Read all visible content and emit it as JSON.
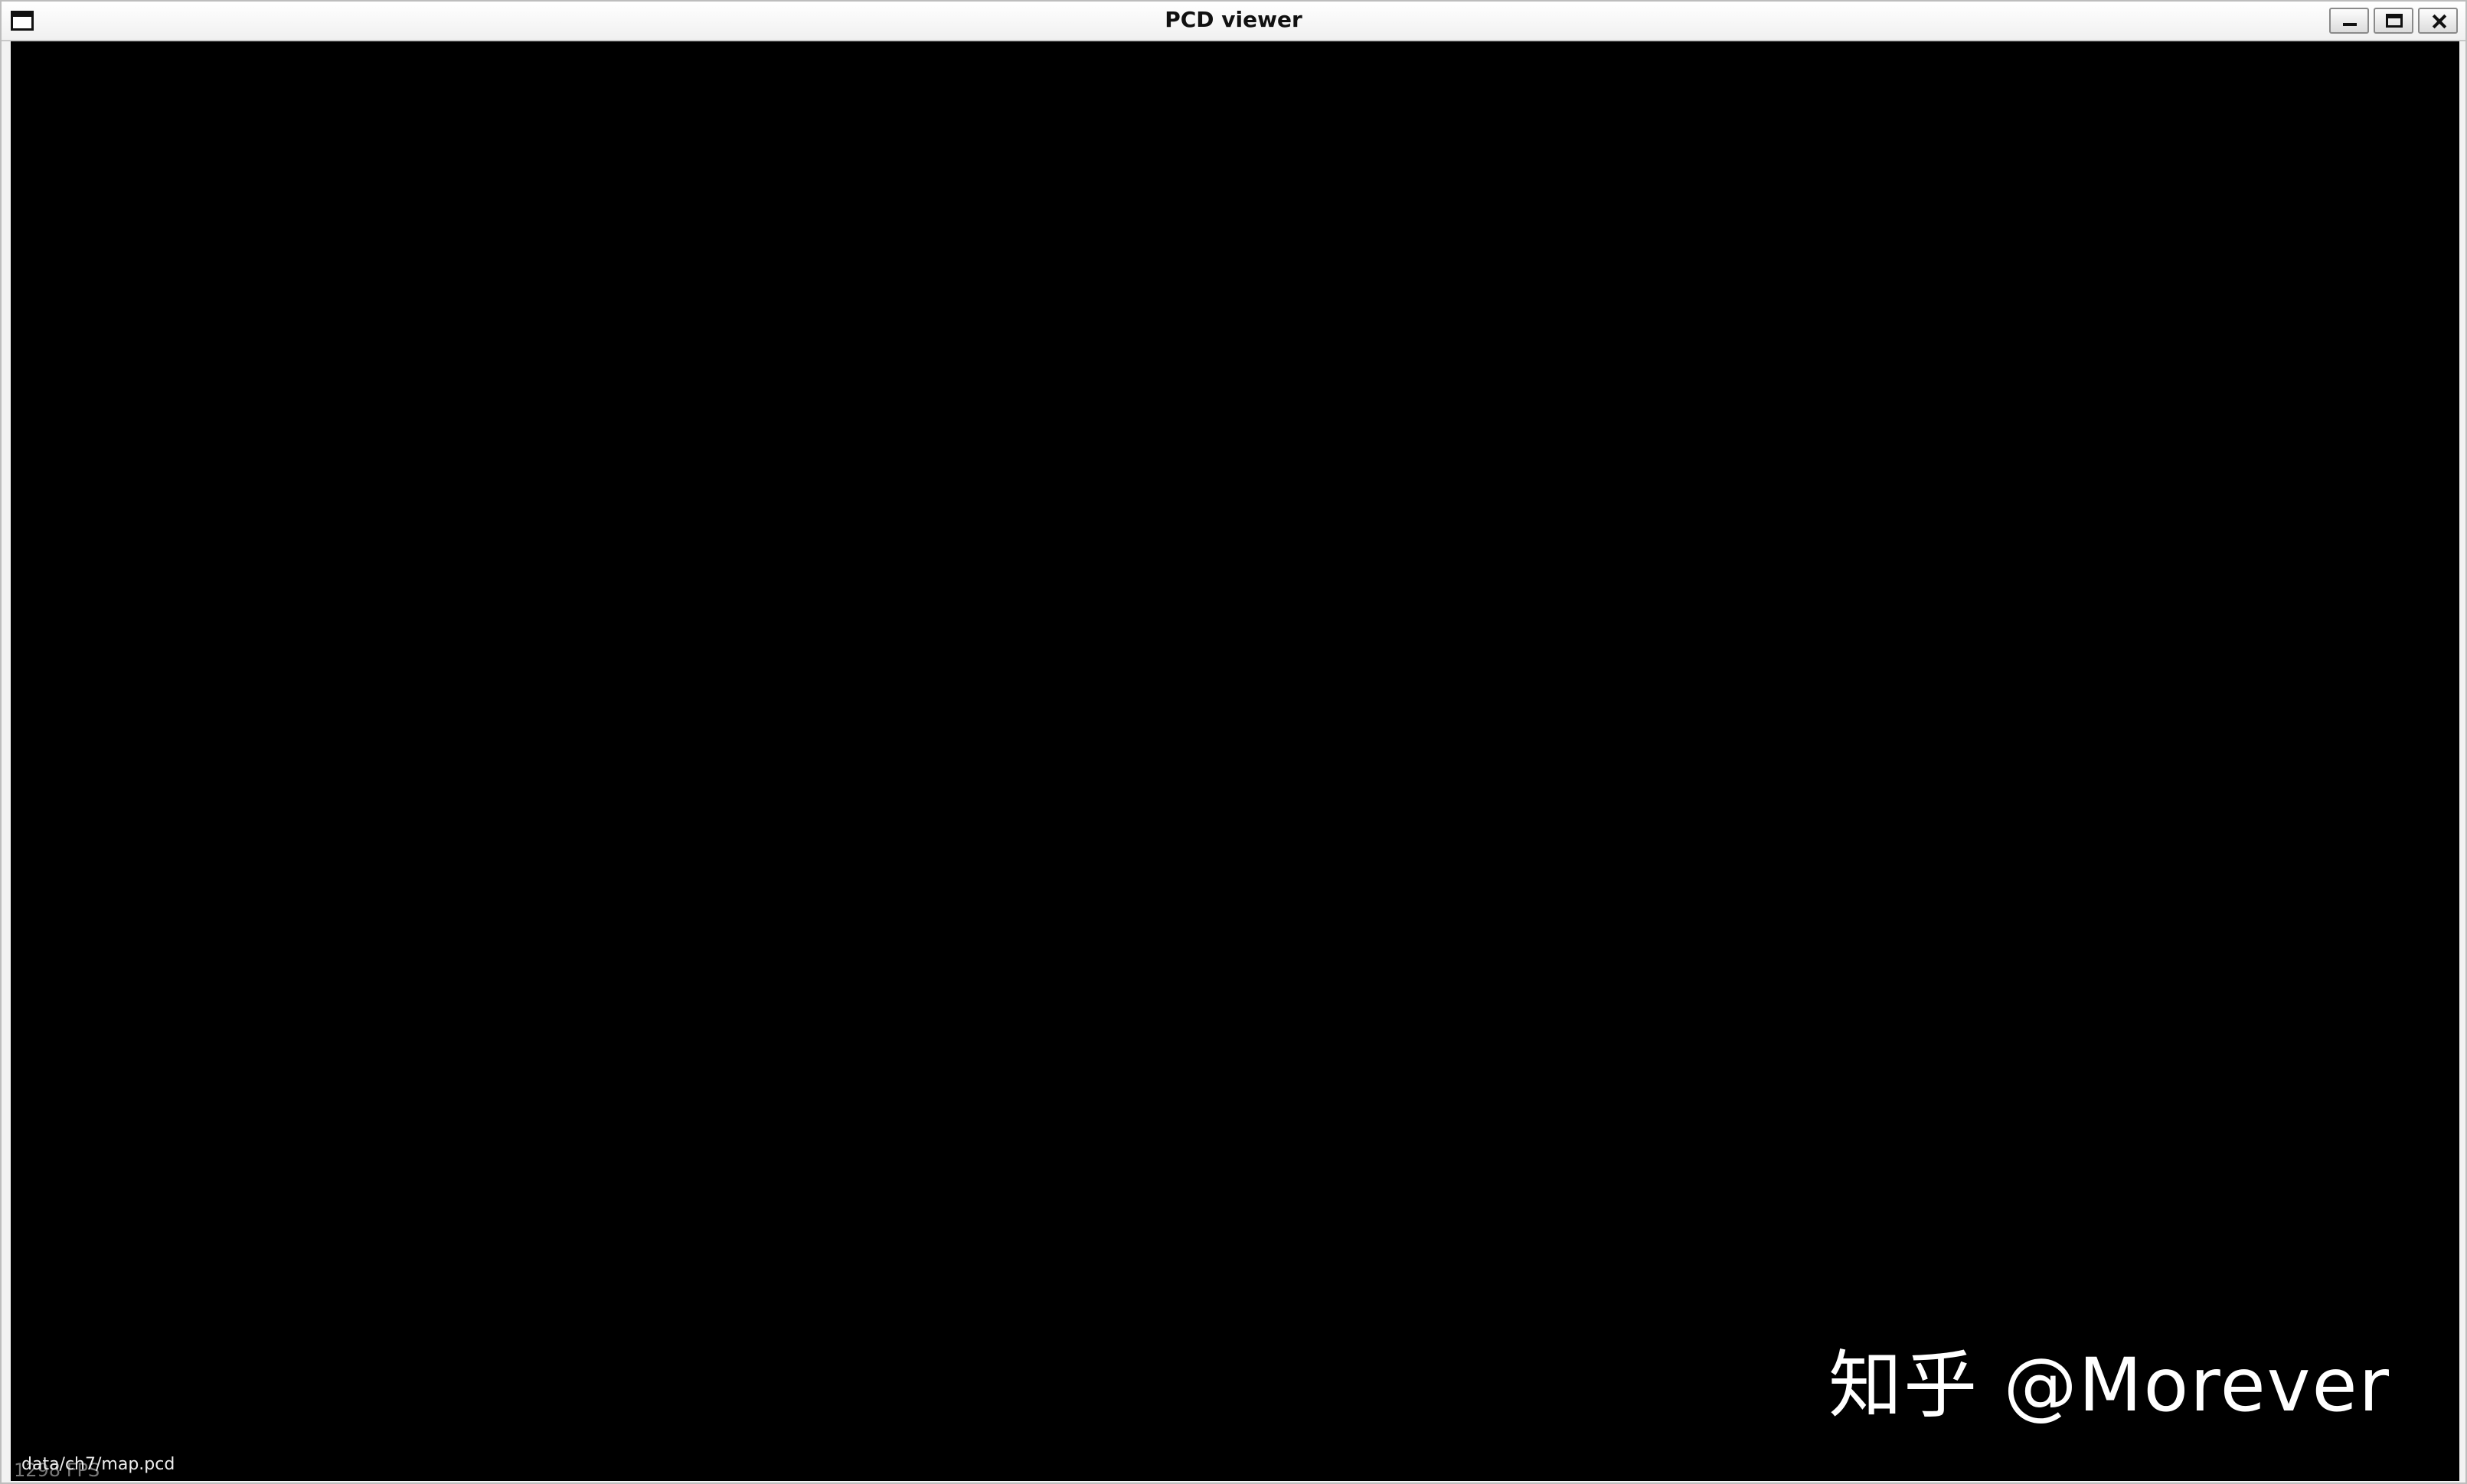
{
  "window": {
    "title": "PCD viewer"
  },
  "viewport": {
    "fps_text": "1298 FPS",
    "filename": "data/ch7/map.pcd",
    "background_color": "#000000"
  },
  "watermark": {
    "text": "知乎 @Morever"
  },
  "icons": {
    "window_menu": "window-menu-icon",
    "minimize": "minimize-icon",
    "maximize": "maximize-icon",
    "close": "close-icon"
  }
}
